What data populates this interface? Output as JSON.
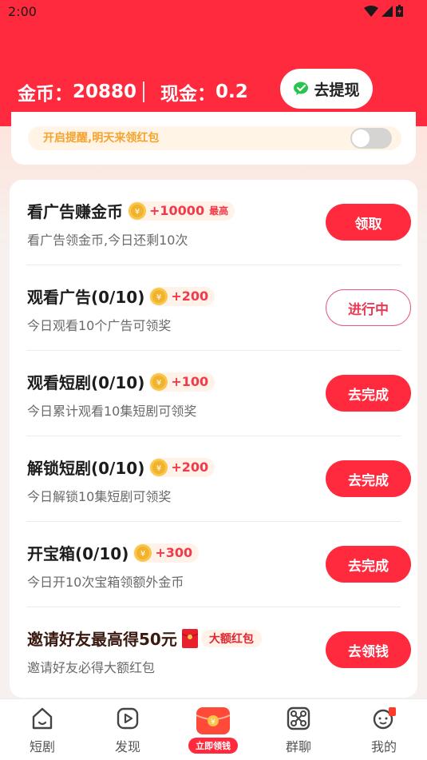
{
  "status_bar": {
    "time": "2:00"
  },
  "header": {
    "coins_label": "金币：",
    "coins_value": "20880",
    "cash_label": "现金：",
    "cash_value": "0.2",
    "withdraw_label": "去提现"
  },
  "reminder": {
    "text": "开启提醒,明天来领红包",
    "enabled": false
  },
  "tasks": [
    {
      "title": "看广告赚金币",
      "reward": "+10000",
      "note": "最高",
      "desc": "看广告领金币,今日还剩10次",
      "button": "领取",
      "style": "filled"
    },
    {
      "title": "观看广告(0/10)",
      "reward": "+200",
      "desc": "今日观看10个广告可领奖",
      "button": "进行中",
      "style": "outline"
    },
    {
      "title": "观看短剧(0/10)",
      "reward": "+100",
      "desc": "今日累计观看10集短剧可领奖",
      "button": "去完成",
      "style": "filled"
    },
    {
      "title": "解锁短剧(0/10)",
      "reward": "+200",
      "desc": "今日解锁10集短剧可领奖",
      "button": "去完成",
      "style": "filled"
    },
    {
      "title": "开宝箱(0/10)",
      "reward": "+300",
      "desc": "今日开10次宝箱领额外金币",
      "button": "去完成",
      "style": "filled"
    },
    {
      "title": "邀请好友最高得50元",
      "tag": "大额红包",
      "desc": "邀请好友必得大额红包",
      "button": "去领钱",
      "style": "filled"
    }
  ],
  "bottom_nav": {
    "items": [
      "短剧",
      "发现",
      "群聊",
      "我的"
    ],
    "center_badge": "立即领钱"
  },
  "colors": {
    "primary": "#ff2a3d",
    "reward": "#f23a4a",
    "reminder_text": "#f5a32c"
  }
}
